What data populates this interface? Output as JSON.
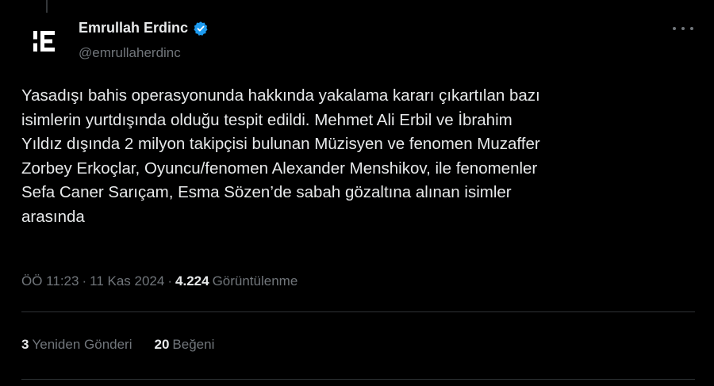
{
  "author": {
    "display_name": "Emrullah Erdinc",
    "handle": "@emrullaherdinc",
    "verified": true,
    "avatar_glyph": "E"
  },
  "tweet": {
    "text": "Yasadışı bahis operasyonunda hakkında yakalama kararı çıkartılan bazı\nisimlerin yurtdışında olduğu tespit edildi. Mehmet Ali Erbil ve İbrahim\nYıldız dışında 2 milyon takipçisi bulunan Müzisyen ve fenomen Muzaffer\nZorbey Erkoçlar, Oyuncu/fenomen Alexander Menshikov, ile fenomenler\nSefa Caner Sarıçam, Esma Sözen’de sabah gözaltına alınan isimler\narasında",
    "time": "ÖÖ 11:23",
    "date": "11 Kas 2024",
    "separator": "·",
    "views_count": "4.224",
    "views_label": "Görüntülenme"
  },
  "stats": {
    "reposts_count": "3",
    "reposts_label": "Yeniden Gönderi",
    "likes_count": "20",
    "likes_label": "Beğeni"
  },
  "icons": {
    "verified": "verified-badge-icon",
    "more": "more-options-icon"
  },
  "colors": {
    "background": "#000000",
    "text": "#e7e9ea",
    "muted": "#71767b",
    "verified": "#1d9bf0",
    "divider": "#2f3336"
  }
}
